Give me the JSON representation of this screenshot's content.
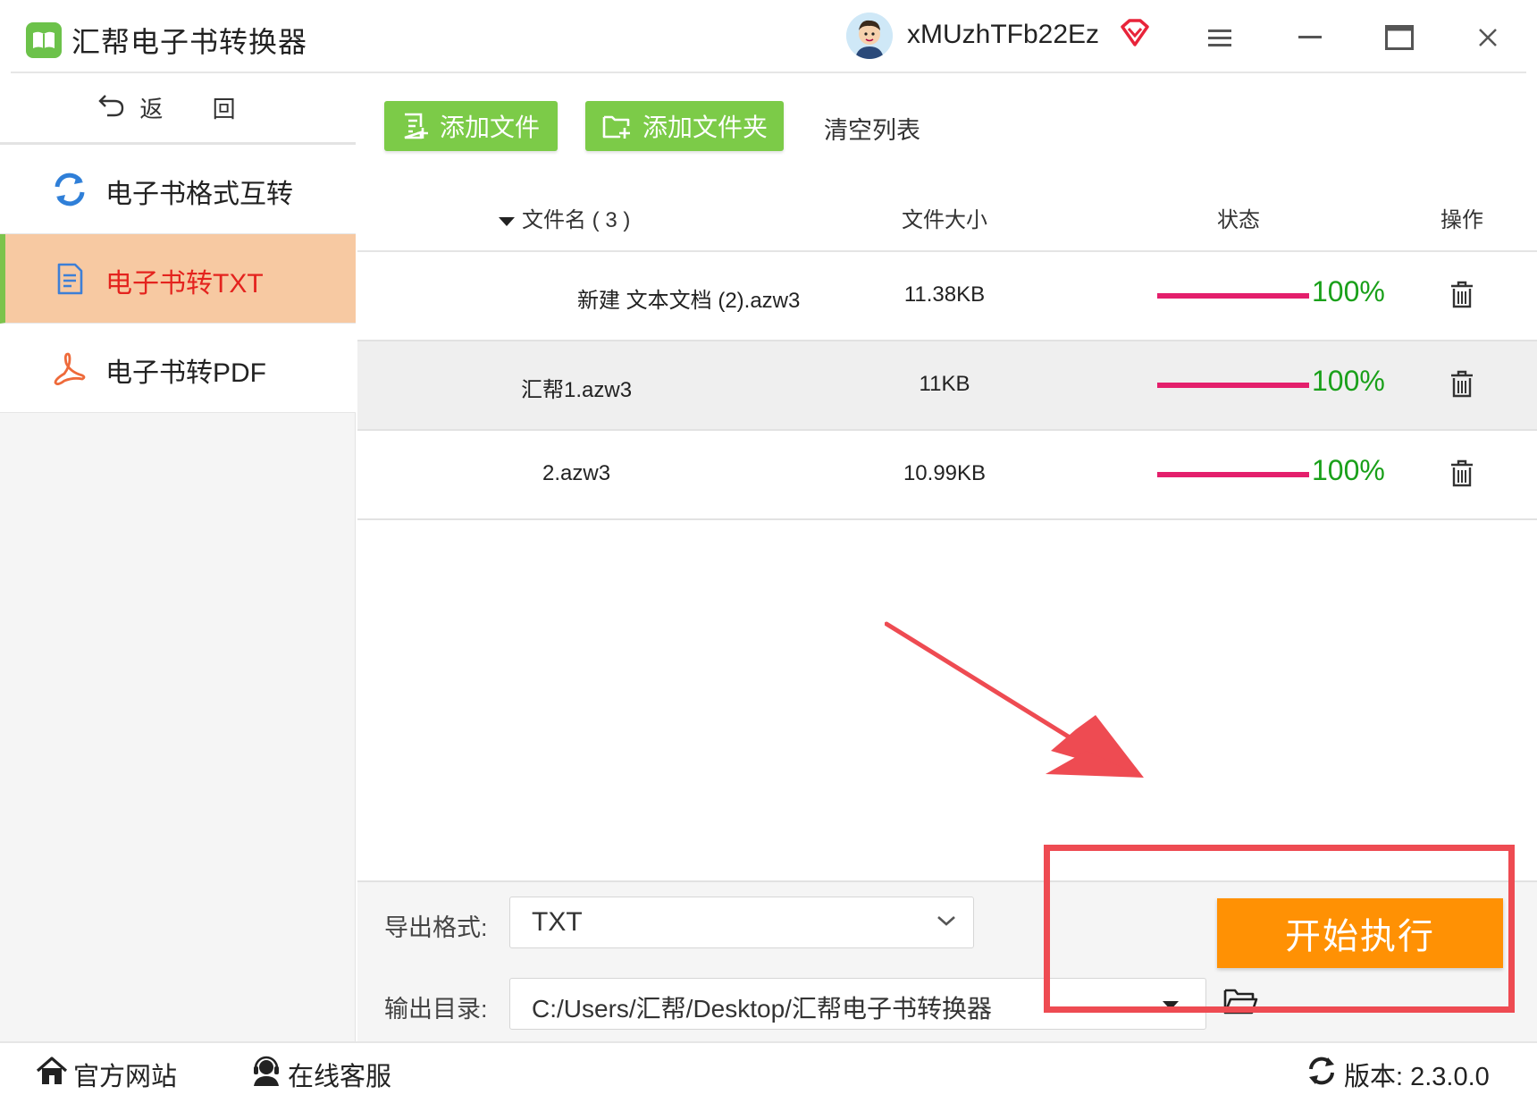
{
  "app": {
    "title": "汇帮电子书转换器",
    "username": "xMUzhTFb22Ez"
  },
  "sidebar": {
    "back_label": "返 回",
    "items": [
      {
        "label": "电子书格式互转",
        "icon": "refresh-icon",
        "active": false
      },
      {
        "label": "电子书转TXT",
        "icon": "document-icon",
        "active": true
      },
      {
        "label": "电子书转PDF",
        "icon": "pdf-icon",
        "active": false
      }
    ]
  },
  "toolbar": {
    "add_file": "添加文件",
    "add_folder": "添加文件夹",
    "clear_list": "清空列表"
  },
  "table": {
    "headers": {
      "filename": "文件名 ( 3 )",
      "size": "文件大小",
      "status": "状态",
      "action": "操作"
    },
    "rows": [
      {
        "name": "新建 文本文档 (2).azw3",
        "size": "11.38KB",
        "progress": "100%"
      },
      {
        "name": "汇帮1.azw3",
        "size": "11KB",
        "progress": "100%"
      },
      {
        "name": "2.azw3",
        "size": "10.99KB",
        "progress": "100%"
      }
    ]
  },
  "output": {
    "format_label": "导出格式:",
    "format_value": "TXT",
    "dir_label": "输出目录:",
    "dir_value": "C:/Users/汇帮/Desktop/汇帮电子书转换器",
    "start_label": "开始执行"
  },
  "statusbar": {
    "website": "官方网站",
    "support": "在线客服",
    "version": "版本: 2.3.0.0"
  },
  "colors": {
    "green": "#7ccb48",
    "orange": "#ff9104",
    "active_bg": "#f7c9a2",
    "active_text": "#e4231e",
    "progress_bar": "#e41f6c",
    "progress_text": "#1aa01a",
    "annotation": "#ee4b52"
  }
}
